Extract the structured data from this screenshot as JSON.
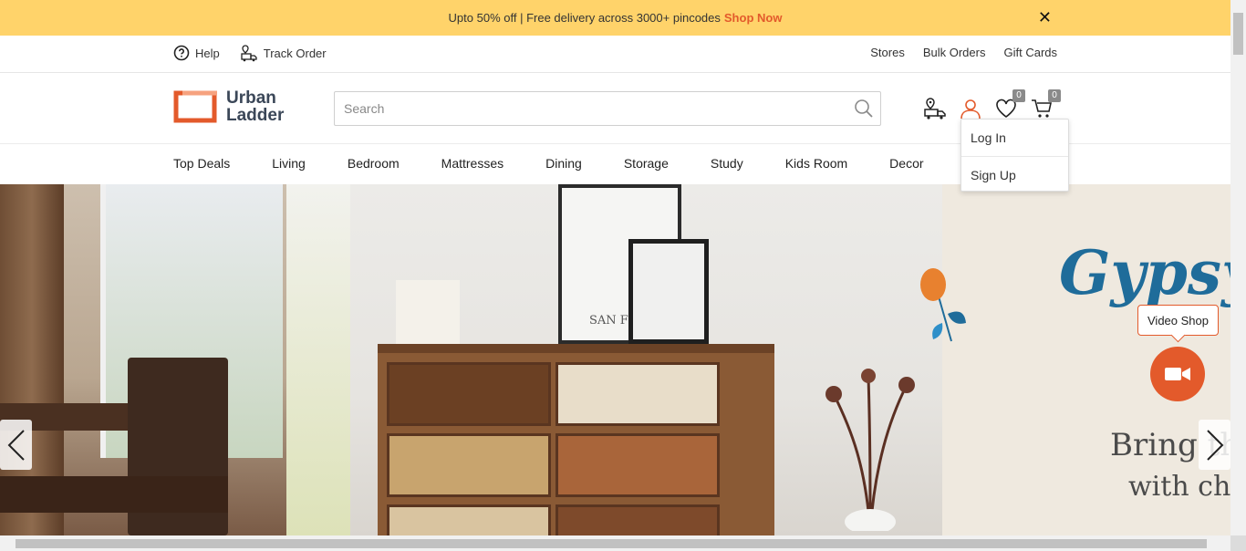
{
  "promo": {
    "text": "Upto 50% off | Free delivery across 3000+ pincodes",
    "link": "Shop Now",
    "close": "✕"
  },
  "utility": {
    "help": "Help",
    "track_order": "Track Order",
    "stores": "Stores",
    "bulk_orders": "Bulk Orders",
    "gift_cards": "Gift Cards"
  },
  "header": {
    "logo_line1": "Urban",
    "logo_line2": "Ladder",
    "search_placeholder": "Search",
    "wishlist_count": "0",
    "cart_count": "0"
  },
  "account_menu": {
    "login": "Log In",
    "signup": "Sign Up"
  },
  "nav": {
    "items": [
      "Top Deals",
      "Living",
      "Bedroom",
      "Mattresses",
      "Dining",
      "Storage",
      "Study",
      "Kids Room",
      "Decor"
    ]
  },
  "hero": {
    "brand": "Gypsy",
    "tagline1": "Bring th",
    "tagline2": "with chi",
    "frame_text": "SAN FR"
  },
  "video": {
    "tooltip": "Video Shop"
  },
  "colors": {
    "accent": "#e35a2b",
    "promo_bg": "#ffd36a",
    "brand_blue": "#1f6c9a"
  }
}
